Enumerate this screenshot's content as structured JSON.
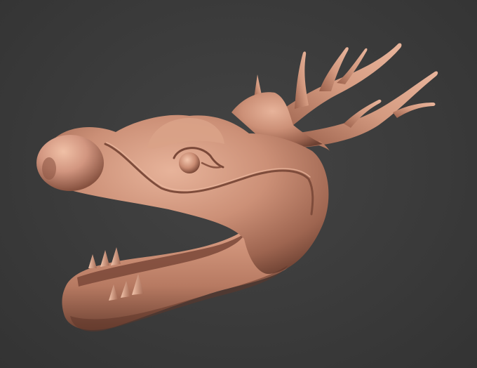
{
  "scene": {
    "subject": "dragon-head",
    "colors": {
      "background": "#3b3b3b",
      "clay_base": "#c98d73",
      "clay_light": "#e2ad93",
      "clay_shadow": "#8a5643",
      "clay_deep": "#6e4233",
      "teeth": "#e6b49a"
    }
  }
}
